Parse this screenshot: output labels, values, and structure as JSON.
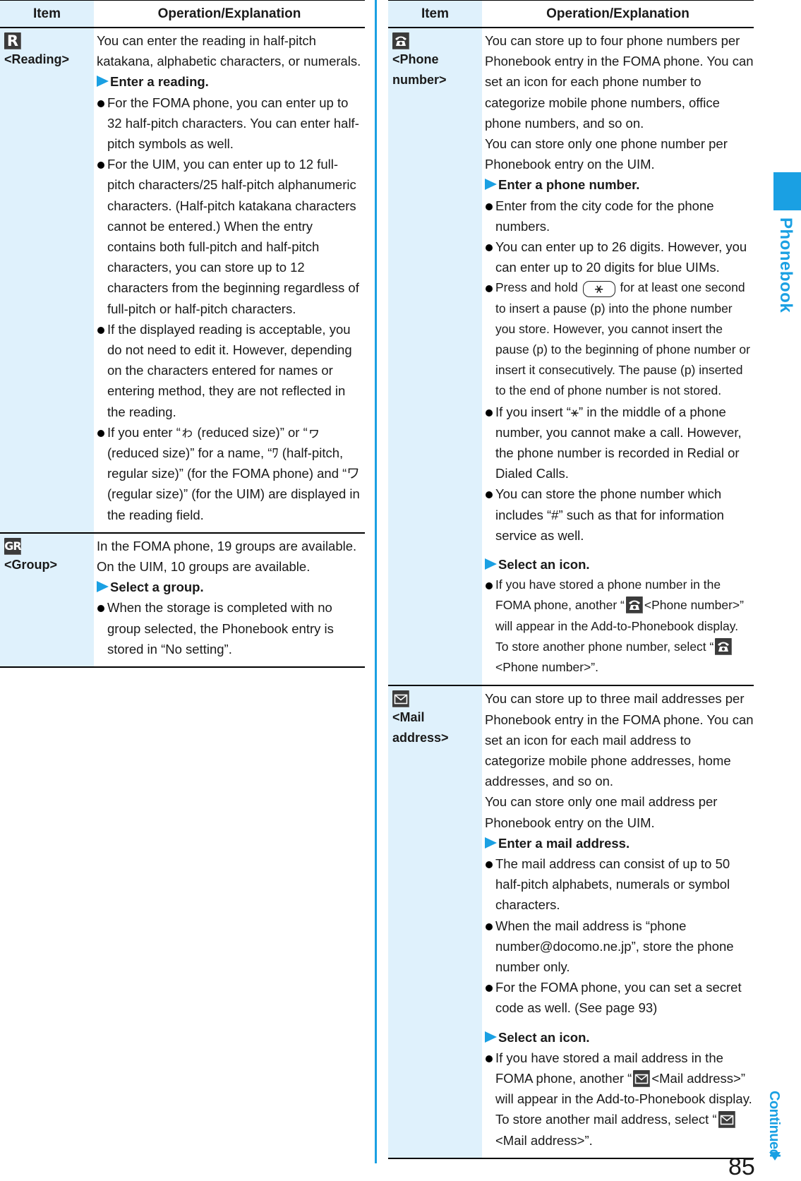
{
  "section": {
    "side_label": "Phonebook",
    "continued": "Continued",
    "page_number": "85",
    "accent_color": "#1aa0e3"
  },
  "left_table": {
    "headers": {
      "item": "Item",
      "operation": "Operation/Explanation"
    },
    "rows": [
      {
        "icon": "reading-icon",
        "icon_text": "R",
        "label": "<Reading>",
        "intro": "You can enter the reading in half-pitch katakana, alphabetic characters, or numerals.",
        "step": "Enter a reading.",
        "bullets": [
          "For the FOMA phone, you can enter up to 32 half-pitch characters. You can enter half-pitch symbols as well.",
          "For the UIM, you can enter up to 12 full-pitch characters/25 half-pitch alphanumeric characters. (Half-pitch katakana characters cannot be entered.) When the entry contains both full-pitch and half-pitch characters, you can store up to 12 characters from the beginning regardless of full-pitch or half-pitch characters.",
          "If the displayed reading is acceptable, you do not need to edit it. However, depending on the characters entered for names or entering method, they are not reflected in the reading.",
          "If you enter “ゎ (reduced size)” or “ヮ (reduced size)” for a name, “ﾜ (half-pitch, regular size)” (for the FOMA phone) and “ワ (regular size)” (for the UIM) are displayed in the reading field."
        ]
      },
      {
        "icon": "group-icon",
        "icon_text": "GR",
        "label": "<Group>",
        "intro": "In the FOMA phone, 19 groups are available. On the UIM, 10 groups are available.",
        "step": "Select a group.",
        "bullets": [
          "When the storage is completed with no group selected, the Phonebook entry is stored in “No setting”."
        ]
      }
    ]
  },
  "right_table": {
    "headers": {
      "item": "Item",
      "operation": "Operation/Explanation"
    },
    "rows": [
      {
        "icon": "phone-icon",
        "label_line1": "<Phone",
        "label_line2": "number>",
        "intro": "You can store up to four phone numbers per Phonebook entry in the FOMA phone. You can set an icon for each phone number to categorize mobile phone numbers, office phone numbers, and so on.",
        "intro2": "You can store only one phone number per Phonebook entry on the UIM.",
        "step": "Enter a phone number.",
        "bullets": [
          "Enter from the city code for the phone numbers.",
          "You can enter up to 26 digits. However, you can enter up to 20 digits for blue UIMs."
        ],
        "pause_bullet": {
          "before_key": "Press and hold",
          "key_label": "⚹",
          "after_key": "for at least one second to insert a pause (p) into the phone number you store. However, you cannot insert the pause (p) to the beginning of phone number or insert it consecutively. The pause (p) inserted to the end of phone number is not stored."
        },
        "bullets2": [
          "If you insert “⚹” in the middle of a phone number, you cannot make a call. However, the phone number is recorded in Redial or Dialed Calls.",
          "You can store the phone number which includes “#” such as that for information service as well."
        ],
        "step2": "Select an icon.",
        "icon_bullet": {
          "part1": "If you have stored a phone number in the FOMA phone, another “",
          "part2": "<Phone number>” will appear in the Add-to-Phonebook display. To store another phone number, select “",
          "part3": "<Phone number>”."
        }
      },
      {
        "icon": "mail-icon",
        "label": "<Mail address>",
        "intro": "You can store up to three mail addresses per Phonebook entry in the FOMA phone. You can set an icon for each mail address to categorize mobile phone addresses, home addresses, and so on.",
        "intro2": "You can store only one mail address per Phonebook entry on the UIM.",
        "step": "Enter a mail address.",
        "bullets": [
          "The mail address can consist of up to 50 half-pitch alphabets, numerals or symbol characters.",
          "When the mail address is “phone number@docomo.ne.jp”, store the phone number only.",
          "For the FOMA phone, you can set a secret code as well. (See page 93)"
        ],
        "step2": "Select an icon.",
        "icon_bullet": {
          "part1": "If you have stored a mail address in the FOMA phone, another “",
          "part2": "<Mail address>” will appear in the Add-to-Phonebook display. To store another mail address, select “",
          "part3": "<Mail address>”."
        }
      }
    ]
  }
}
